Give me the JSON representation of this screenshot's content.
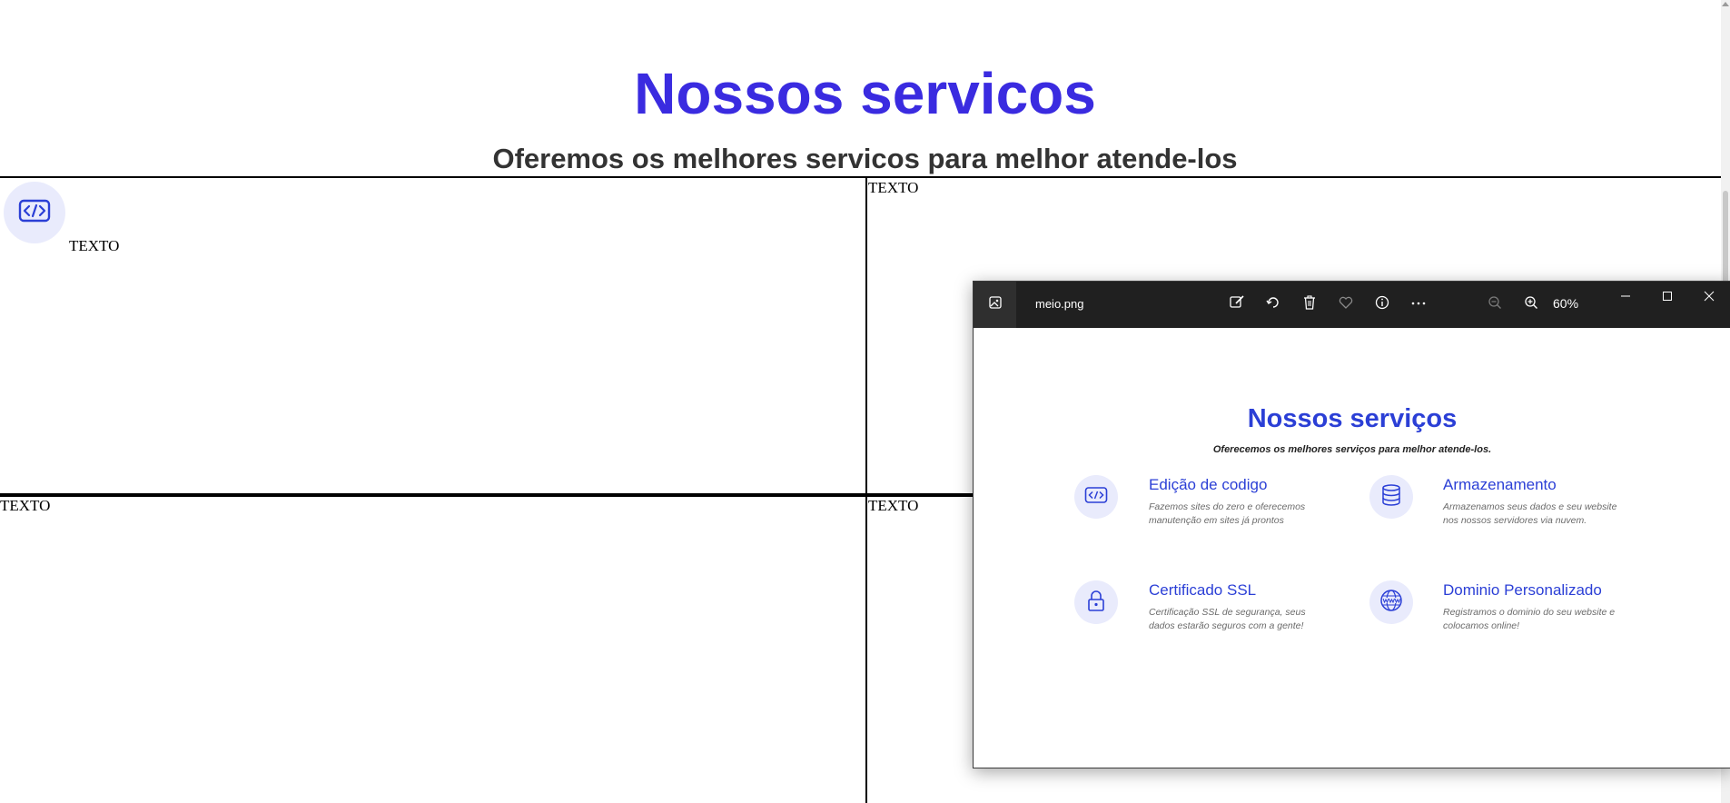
{
  "page": {
    "title": "Nossos servicos",
    "subtitle": "Oferemos os melhores servicos para melhor atende-los",
    "cells": [
      {
        "text": "TEXTO",
        "icon": "code-icon"
      },
      {
        "text": "TEXTO"
      },
      {
        "text": "TEXTO"
      },
      {
        "text": "TEXTO"
      }
    ],
    "colors": {
      "title": "#3a2be0",
      "subtitle": "#333333",
      "icon_circle": "#e9ebfc",
      "icon": "#2b3fd6"
    }
  },
  "viewer": {
    "file_name": "meio.png",
    "zoom": "60%",
    "toolbar": [
      "edit-icon",
      "rotate-icon",
      "delete-icon",
      "favorite-icon",
      "info-icon",
      "more-icon",
      "zoom-out-icon",
      "zoom-in-icon"
    ],
    "window_controls": [
      "minimize-icon",
      "maximize-icon",
      "close-icon"
    ],
    "image": {
      "title": "Nossos serviços",
      "subtitle": "Oferecemos os melhores serviços para melhor atende-los.",
      "services": [
        {
          "title": "Edição de codigo",
          "desc": "Fazemos sites do zero e oferecemos manutenção em sites já prontos",
          "icon": "code-icon"
        },
        {
          "title": "Armazenamento",
          "desc": "Armazenamos seus dados e seu website nos nossos servidores via nuvem.",
          "icon": "database-icon"
        },
        {
          "title": "Certificado SSL",
          "desc": "Certificação SSL de segurança, seus dados estarão seguros com a gente!",
          "icon": "lock-icon"
        },
        {
          "title": "Dominio Personalizado",
          "desc": "Registramos o dominio do seu website e colocamos online!",
          "icon": "globe-www-icon"
        }
      ]
    },
    "colors": {
      "titlebar": "#202020",
      "accent": "#2b3fd6",
      "desc_text": "#6b6b6b"
    }
  }
}
